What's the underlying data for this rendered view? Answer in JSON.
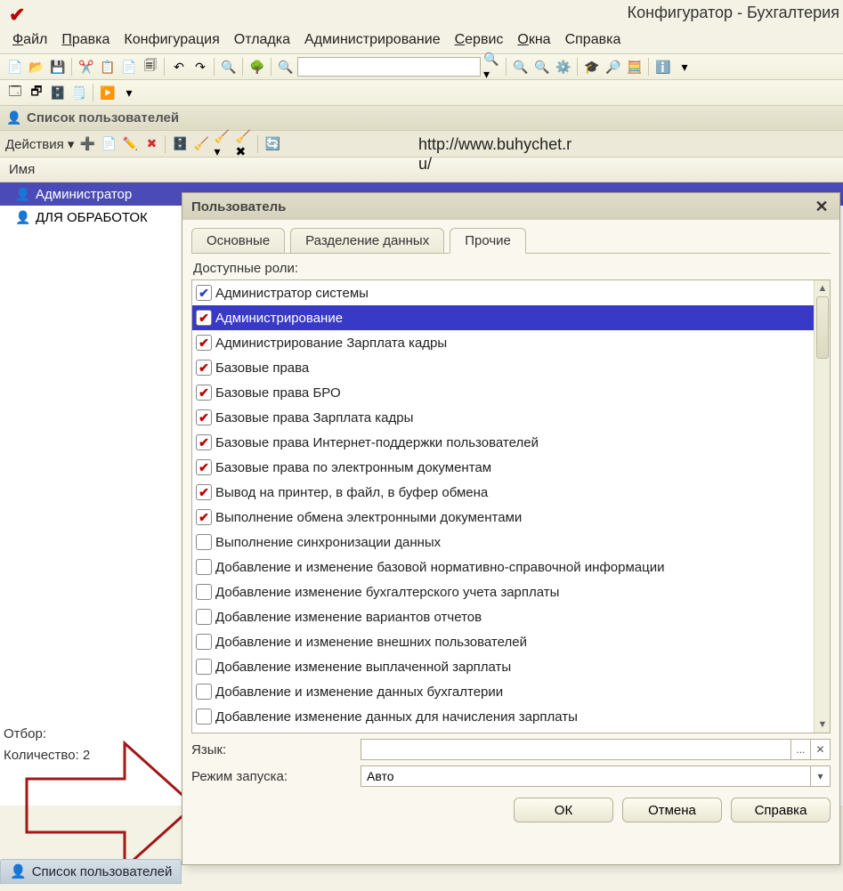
{
  "app": {
    "title": "Конфигуратор - Бухгалтерия"
  },
  "menu": {
    "file": "Файл",
    "edit": "Правка",
    "config": "Конфигурация",
    "debug": "Отладка",
    "admin": "Администрирование",
    "service": "Сервис",
    "windows": "Окна",
    "help": "Справка"
  },
  "panel": {
    "title": "Список пользователей"
  },
  "watermark": {
    "line1": "http://www.buhychet.r",
    "line2": "u/"
  },
  "actions": {
    "label": "Действия"
  },
  "columns": {
    "name": "Имя"
  },
  "users": [
    {
      "name": "Администратор",
      "selected": true
    },
    {
      "name": "ДЛЯ ОБРАБОТОК",
      "selected": false
    }
  ],
  "footer": {
    "filter": "Отбор:",
    "count_label": "Количество: ",
    "count_value": "2",
    "tab": "Список пользователей"
  },
  "dialog": {
    "title": "Пользователь",
    "tabs": {
      "main": "Основные",
      "split": "Разделение данных",
      "other": "Прочие",
      "active": "other"
    },
    "roles_label": "Доступные роли:",
    "roles": [
      {
        "label": "Администратор системы",
        "checked": true,
        "blue": true
      },
      {
        "label": "Администрирование",
        "checked": true,
        "selected": true
      },
      {
        "label": "Администрирование Зарплата кадры",
        "checked": true
      },
      {
        "label": "Базовые права",
        "checked": true
      },
      {
        "label": "Базовые права БРО",
        "checked": true
      },
      {
        "label": "Базовые права Зарплата кадры",
        "checked": true
      },
      {
        "label": "Базовые права Интернет-поддержки пользователей",
        "checked": true
      },
      {
        "label": "Базовые права по электронным документам",
        "checked": true
      },
      {
        "label": "Вывод на принтер, в файл, в буфер обмена",
        "checked": true
      },
      {
        "label": "Выполнение обмена электронными документами",
        "checked": true
      },
      {
        "label": "Выполнение синхронизации данных",
        "checked": false
      },
      {
        "label": "Добавление и изменение базовой нормативно-справочной информации",
        "checked": false
      },
      {
        "label": "Добавление изменение бухгалтерского учета зарплаты",
        "checked": false
      },
      {
        "label": "Добавление изменение вариантов отчетов",
        "checked": false
      },
      {
        "label": "Добавление и изменение внешних пользователей",
        "checked": false
      },
      {
        "label": "Добавление изменение выплаченной зарплаты",
        "checked": false
      },
      {
        "label": "Добавление и изменение данных бухгалтерии",
        "checked": false
      },
      {
        "label": "Добавление изменение данных для начисления зарплаты",
        "checked": false
      }
    ],
    "lang_label": "Язык:",
    "lang_value": "",
    "mode_label": "Режим запуска:",
    "mode_value": "Авто",
    "ok": "ОК",
    "cancel": "Отмена",
    "help": "Справка",
    "select_btn": "...",
    "clear_btn": "✕"
  }
}
